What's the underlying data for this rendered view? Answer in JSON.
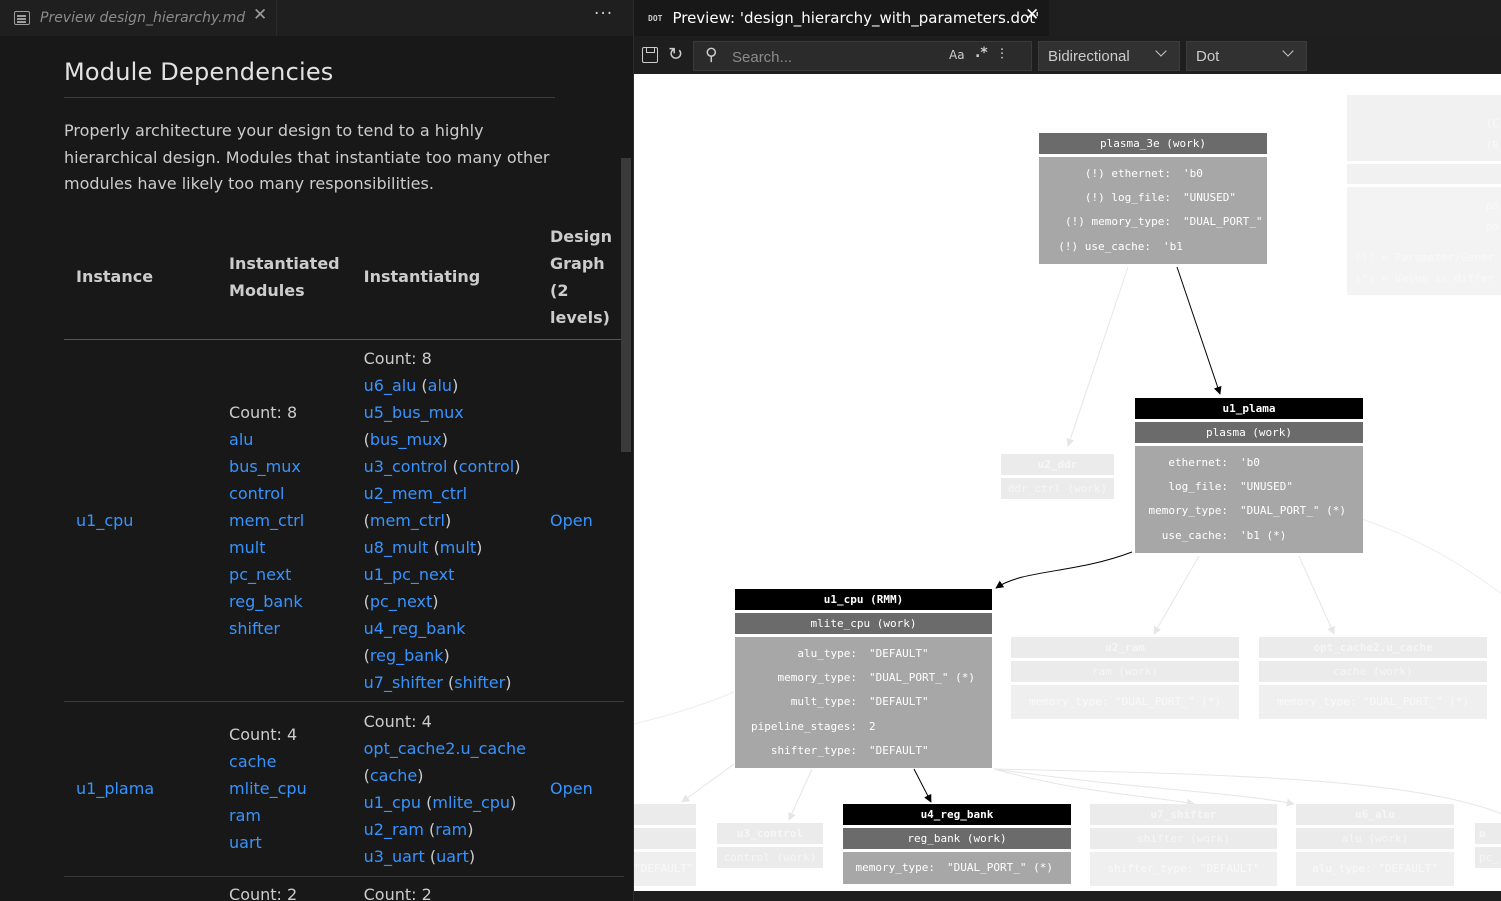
{
  "left_tab": {
    "label": "Preview design_hierarchy.md",
    "close": "✕"
  },
  "left_more": "···",
  "doc": {
    "title": "Module Dependencies",
    "paragraph": "Properly architecture your design to tend to a highly hierarchical design. Modules that instantiate too many other modules have likely too many responsibilities.",
    "headers": [
      "Instance",
      "Instantiated Modules",
      "Instantiating",
      "Design Graph (2 levels)"
    ],
    "rows": [
      {
        "instance": "u1_cpu",
        "instantiated_count": "Count: 8",
        "instantiated": [
          "alu",
          "bus_mux",
          "control",
          "mem_ctrl",
          "mult",
          "pc_next",
          "reg_bank",
          "shifter"
        ],
        "instantiating_count": "Count: 8",
        "instantiating": [
          {
            "inst": "u6_alu",
            "mod": "alu"
          },
          {
            "inst": "u5_bus_mux",
            "mod": "bus_mux"
          },
          {
            "inst": "u3_control",
            "mod": "control"
          },
          {
            "inst": "u2_mem_ctrl",
            "mod": "mem_ctrl"
          },
          {
            "inst": "u8_mult",
            "mod": "mult"
          },
          {
            "inst": "u1_pc_next",
            "mod": "pc_next"
          },
          {
            "inst": "u4_reg_bank",
            "mod": "reg_bank"
          },
          {
            "inst": "u7_shifter",
            "mod": "shifter"
          }
        ],
        "graph_link": "Open"
      },
      {
        "instance": "u1_plama",
        "instantiated_count": "Count: 4",
        "instantiated": [
          "cache",
          "mlite_cpu",
          "ram",
          "uart"
        ],
        "instantiating_count": "Count: 4",
        "instantiating": [
          {
            "inst": "opt_cache2.u_cache",
            "mod": "cache"
          },
          {
            "inst": "u1_cpu",
            "mod": "mlite_cpu"
          },
          {
            "inst": "u2_ram",
            "mod": "ram"
          },
          {
            "inst": "u3_uart",
            "mod": "uart"
          }
        ],
        "graph_link": "Open"
      },
      {
        "instance": "",
        "instantiated_count": "Count: 2",
        "instantiated": [],
        "instantiating_count": "Count: 2",
        "instantiating": [],
        "graph_link": ""
      }
    ]
  },
  "right_tab": {
    "icon": "DOT",
    "label": "Preview: 'design_hierarchy_with_parameters.dot'",
    "close": "✕"
  },
  "toolbar": {
    "search_placeholder": "Search...",
    "match_case": "Aa",
    "regex": ".*",
    "direction": "Bidirectional",
    "engine": "Dot"
  },
  "graph": {
    "plasma_3e": {
      "header": "plasma_3e (work)",
      "params": [
        {
          "k": "(!) ethernet:",
          "v": "'b0"
        },
        {
          "k": "(!) log_file:",
          "v": "\"UNUSED\""
        },
        {
          "k": "(!) memory_type:",
          "v": "\"DUAL_PORT_\""
        },
        {
          "k": "(!) use_cache:",
          "v": "'b1"
        }
      ]
    },
    "u1_plama": {
      "title": "u1_plama",
      "header": "plasma (work)",
      "params": [
        {
          "k": "ethernet:",
          "v": "'b0"
        },
        {
          "k": "log_file:",
          "v": "\"UNUSED\""
        },
        {
          "k": "memory_type:",
          "v": "\"DUAL_PORT_\" (*)"
        },
        {
          "k": "use_cache:",
          "v": "'b1 (*)"
        }
      ]
    },
    "u1_cpu": {
      "title": "u1_cpu (RMM)",
      "header": "mlite_cpu (work)",
      "params": [
        {
          "k": "alu_type:",
          "v": "\"DEFAULT\""
        },
        {
          "k": "memory_type:",
          "v": "\"DUAL_PORT_\" (*)"
        },
        {
          "k": "mult_type:",
          "v": "\"DEFAULT\""
        },
        {
          "k": "pipeline_stages:",
          "v": "2"
        },
        {
          "k": "shifter_type:",
          "v": "\"DEFAULT\""
        }
      ]
    },
    "u4_reg_bank": {
      "title": "u4_reg_bank",
      "header": "reg_bank (work)",
      "params": [
        {
          "k": "memory_type:",
          "v": "\"DUAL_PORT_\" (*)"
        }
      ]
    },
    "u2_ddr": {
      "title": "u2_ddr",
      "header": "ddr_ctrl (work)"
    },
    "u2_ram": {
      "title": "u2_ram",
      "header": "ram (work)",
      "param": "memory_type:  \"DUAL_PORT_\" (*)"
    },
    "opt_cache2": {
      "title": "opt_cache2.u_cache",
      "header": "cache (work)",
      "param": "memory_type:  \"DUAL_PORT_\" (*)"
    },
    "u3_control": {
      "title": "u3_control",
      "header": "control (work)"
    },
    "u7_shifter": {
      "title": "u7_shifter",
      "header": "shifter (work)",
      "param": "shifter_type:  \"DEFAULT\""
    },
    "u6_alu": {
      "title": "u6_alu",
      "header": "alu (work)",
      "param": "alu_type:  \"DEFAULT\""
    },
    "edge_left": {
      "param": "\"DEFAULT\""
    },
    "edge_right": {
      "title": "u",
      "param": "pc_"
    },
    "legend": {
      "lines": [
        "(C",
        "(R",
        "pa",
        "pa",
        "(!) = Parameter/Gener",
        "(*) = Value is differ"
      ]
    },
    "colors": {
      "black": "#000000",
      "dark": "#6b6b6b",
      "grey": "#a7a7a7",
      "faded": "#ebebeb"
    }
  }
}
